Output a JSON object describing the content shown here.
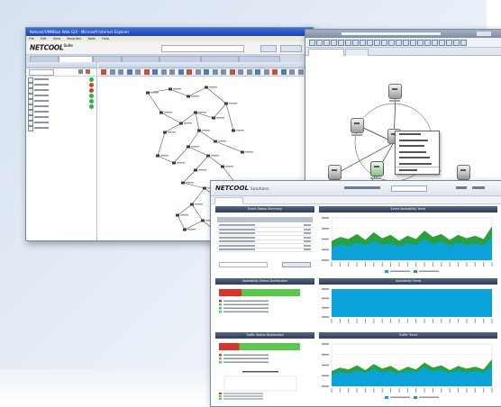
{
  "window1": {
    "title": "Netcool/OMNIbus Web GUI - Microsoft Internet Explorer",
    "menu": [
      "File",
      "Edit",
      "View",
      "Favorites",
      "Tools",
      "Help"
    ],
    "logo": "NETCOOL",
    "logo_mark": "Suite",
    "status_colors": [
      "#2db34a",
      "#d63c2f",
      "#d63c2f",
      "#2db34a",
      "#2db34a",
      "#2db34a"
    ]
  },
  "window3": {
    "logo": "NETCOOL",
    "logo_sub": "Solutions",
    "panels": [
      {
        "title": "Event Status Summary",
        "kind": "table"
      },
      {
        "title": "Event Availability Trend",
        "kind": "area",
        "colors": [
          "#0aa2d8",
          "#2aa13e"
        ]
      },
      {
        "title": "Availability Status Distribution",
        "kind": "bars",
        "fill_fraction": 0.72,
        "colors": [
          "#d8322b",
          "#58c94d"
        ]
      },
      {
        "title": "Availability Trend",
        "kind": "flat",
        "colors": [
          "#0aa2d8"
        ]
      },
      {
        "title": "Traffic Status Distribution",
        "kind": "bars",
        "fill_fraction": 0.75,
        "colors": [
          "#d8322b",
          "#58c94d"
        ]
      },
      {
        "title": "Traffic Trend",
        "kind": "area",
        "colors": [
          "#0aa2d8",
          "#2aa13e"
        ]
      }
    ],
    "table_rows": 7,
    "trend_values_a": [
      0.45,
      0.55,
      0.5,
      0.62,
      0.48,
      0.66,
      0.52,
      0.6,
      0.46,
      0.58,
      0.5,
      0.7,
      0.55,
      0.62,
      0.48,
      0.6,
      0.52,
      0.58,
      0.5,
      0.8
    ],
    "trend_values_b": [
      0.3,
      0.38,
      0.33,
      0.42,
      0.35,
      0.45,
      0.37,
      0.4,
      0.33,
      0.41,
      0.36,
      0.5,
      0.38,
      0.44,
      0.34,
      0.42,
      0.36,
      0.4,
      0.35,
      0.55
    ]
  }
}
